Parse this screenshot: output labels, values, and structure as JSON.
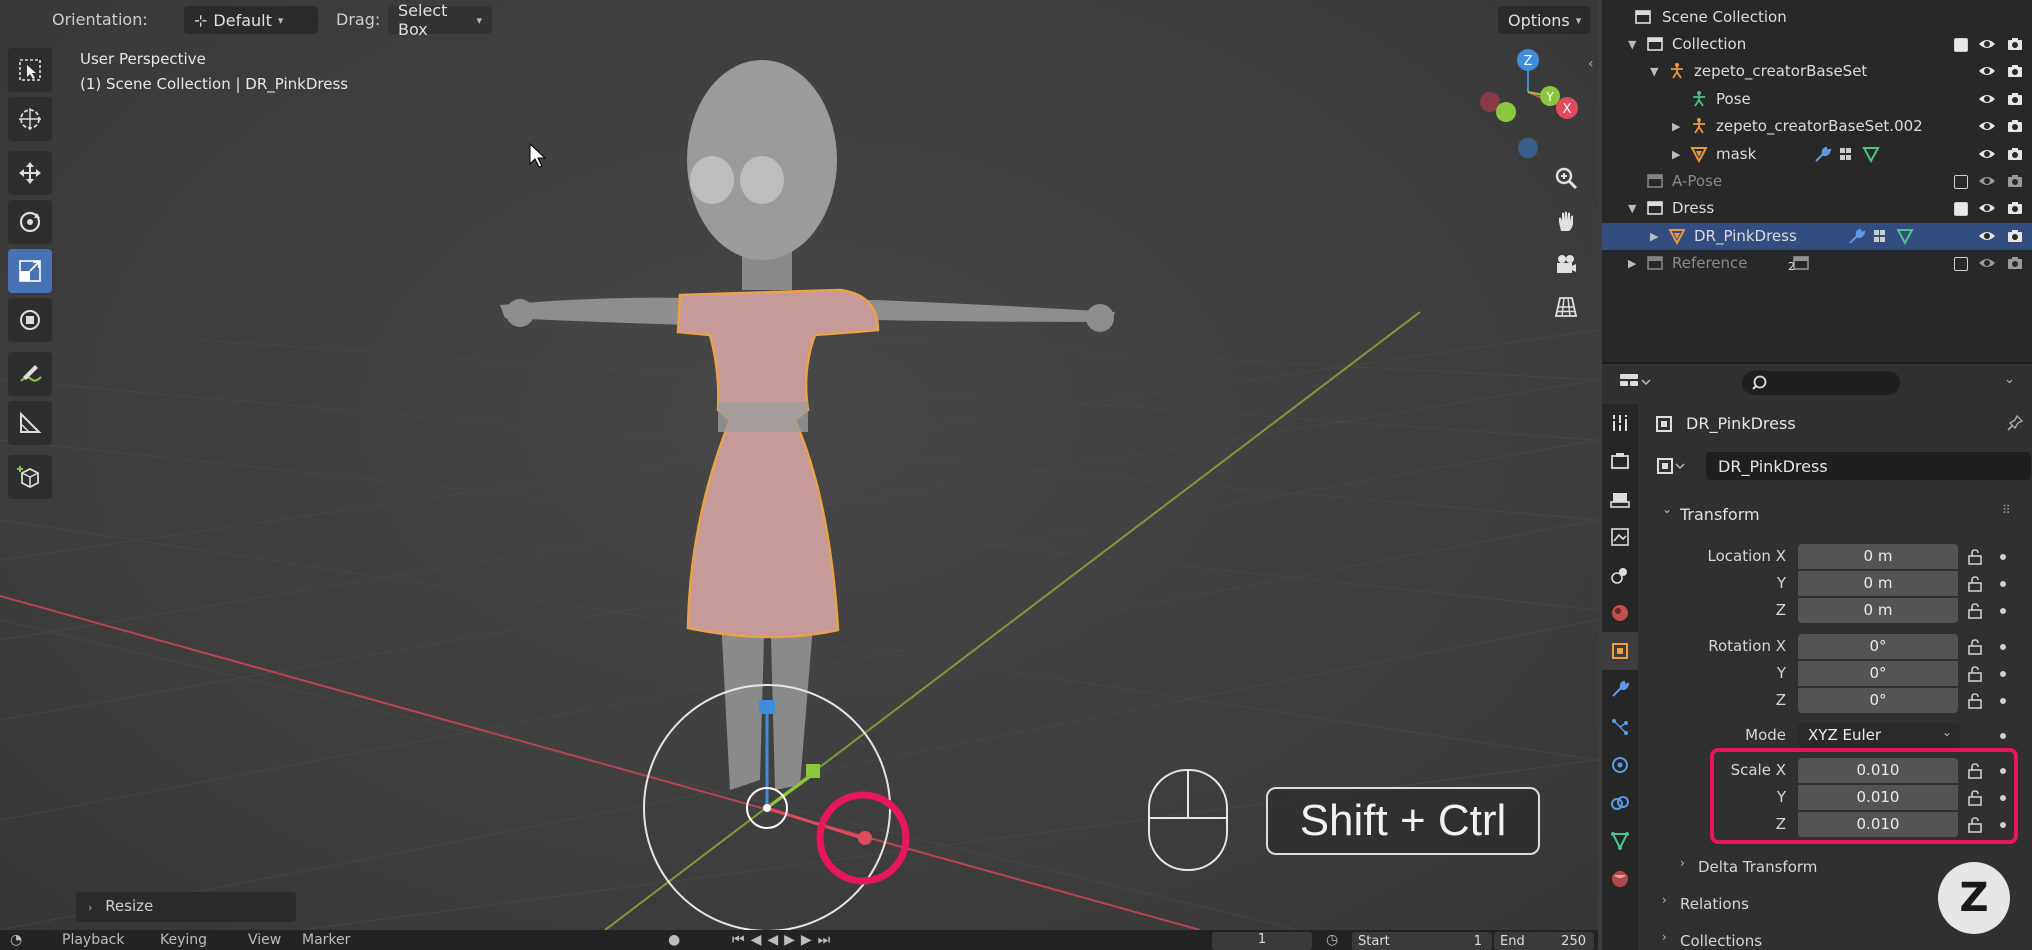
{
  "viewport_header": {
    "orientation_label": "Orientation:",
    "orientation_value": "Default",
    "drag_label": "Drag:",
    "drag_value": "Select Box",
    "options_label": "Options"
  },
  "viewport_info": {
    "view_name": "User Perspective",
    "context": "(1) Scene Collection | DR_PinkDress"
  },
  "toolbar": {
    "tools": [
      "select-box-tool",
      "cursor-tool",
      "move-tool",
      "rotate-tool",
      "scale-tool",
      "transform-tool",
      "annotate-tool",
      "measure-tool",
      "add-cube-tool"
    ],
    "active_tool": "scale-tool"
  },
  "navigation_icons": [
    "zoom-icon",
    "hand-pan-icon",
    "camera-icon",
    "grid-ortho-icon"
  ],
  "gizmo_axes": [
    "Z",
    "Y",
    "X"
  ],
  "resize_panel_label": "Resize",
  "shortcut_overlay": "Shift + Ctrl",
  "timeline": {
    "playback_label": "Playback",
    "keying_label": "Keying",
    "view_label": "View",
    "marker_label": "Marker",
    "current_frame": "1",
    "start_label": "Start",
    "start_value": "1",
    "end_label": "End",
    "end_value": "250"
  },
  "outliner": {
    "scene_collection": "Scene Collection",
    "rows": [
      {
        "label": "Collection",
        "depth": 1,
        "icon": "collection-icon",
        "expanded": true,
        "checkbox": true,
        "checked": true,
        "dim": false,
        "selected": false
      },
      {
        "label": "zepeto_creatorBaseSet",
        "depth": 2,
        "icon": "armature-icon",
        "expanded": true,
        "checkbox": false,
        "checked": false,
        "dim": false,
        "selected": false
      },
      {
        "label": "Pose",
        "depth": 3,
        "icon": "pose-icon",
        "expanded": null,
        "checkbox": false,
        "checked": false,
        "dim": false,
        "selected": false
      },
      {
        "label": "zepeto_creatorBaseSet.002",
        "depth": 3,
        "icon": "armature-icon",
        "expanded": false,
        "checkbox": false,
        "checked": false,
        "dim": false,
        "selected": false
      },
      {
        "label": "mask",
        "depth": 3,
        "icon": "mesh-icon",
        "expanded": false,
        "checkbox": false,
        "checked": false,
        "dim": false,
        "selected": false
      },
      {
        "label": "A-Pose",
        "depth": 1,
        "icon": "collection-icon",
        "expanded": null,
        "checkbox": true,
        "checked": false,
        "dim": true,
        "selected": false
      },
      {
        "label": "Dress",
        "depth": 1,
        "icon": "collection-icon",
        "expanded": true,
        "checkbox": true,
        "checked": true,
        "dim": false,
        "selected": false
      },
      {
        "label": "DR_PinkDress",
        "depth": 2,
        "icon": "mesh-icon",
        "expanded": false,
        "checkbox": false,
        "checked": false,
        "dim": false,
        "selected": true
      },
      {
        "label": "Reference",
        "depth": 1,
        "icon": "collection-icon",
        "expanded": false,
        "checkbox": true,
        "checked": false,
        "dim": true,
        "selected": false
      }
    ],
    "reference_badge": "2"
  },
  "properties": {
    "object_name": "DR_PinkDress",
    "datablock_name": "DR_PinkDress",
    "transform_header": "Transform",
    "location_label": "Location X",
    "location": [
      "0 m",
      "0 m",
      "0 m"
    ],
    "rotation_label": "Rotation X",
    "rotation": [
      "0°",
      "0°",
      "0°"
    ],
    "mode_label": "Mode",
    "mode_value": "XYZ Euler",
    "scale_label": "Scale X",
    "scale": [
      "0.010",
      "0.010",
      "0.010"
    ],
    "axis_y": "Y",
    "axis_z": "Z",
    "delta_transform": "Delta Transform",
    "relations": "Relations",
    "collections": "Collections"
  },
  "logo_letter": "Z",
  "colors": {
    "selection_blue": "#334d80",
    "active_tool": "#4772b3",
    "highlight_pink": "#e8175d",
    "axis_x": "#e04a5f",
    "axis_y": "#8cc63f",
    "axis_z": "#3f8ddc"
  }
}
